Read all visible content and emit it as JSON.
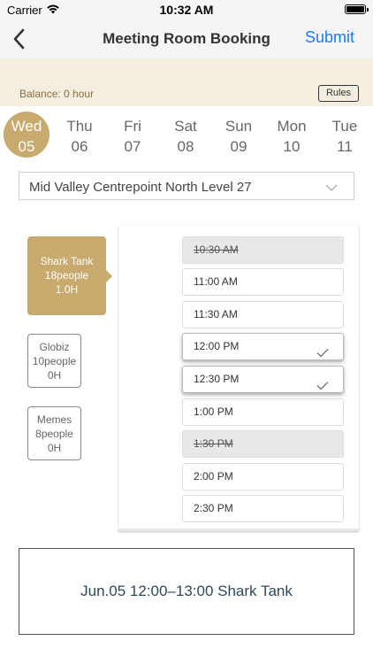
{
  "status_bar": {
    "carrier": "Carrier",
    "time": "10:32 AM"
  },
  "nav": {
    "title": "Meeting Room Booking",
    "submit_label": "Submit",
    "accent_color": "#1a7cf3"
  },
  "balance": {
    "text": "Balance: 0 hour",
    "rules_label": "Rules"
  },
  "dates": [
    {
      "dow": "Wed",
      "day": "05",
      "selected": true
    },
    {
      "dow": "Thu",
      "day": "06"
    },
    {
      "dow": "Fri",
      "day": "07"
    },
    {
      "dow": "Sat",
      "day": "08"
    },
    {
      "dow": "Sun",
      "day": "09"
    },
    {
      "dow": "Mon",
      "day": "10"
    },
    {
      "dow": "Tue",
      "day": "11"
    }
  ],
  "location": {
    "value": "Mid Valley Centrepoint North Level 27"
  },
  "rooms": [
    {
      "name": "Shark Tank",
      "capacity": "18people",
      "hours": "1.0H",
      "selected": true
    },
    {
      "name": "Globiz",
      "capacity": "10people",
      "hours": "0H"
    },
    {
      "name": "Memes",
      "capacity": "8people",
      "hours": "0H"
    }
  ],
  "slots": [
    {
      "time": "10:30 AM",
      "state": "disabled"
    },
    {
      "time": "11:00 AM",
      "state": "available"
    },
    {
      "time": "11:30 AM",
      "state": "available"
    },
    {
      "time": "12:00 PM",
      "state": "selected"
    },
    {
      "time": "12:30 PM",
      "state": "selected"
    },
    {
      "time": "1:00 PM",
      "state": "available"
    },
    {
      "time": "1:30 PM",
      "state": "disabled"
    },
    {
      "time": "2:00 PM",
      "state": "available"
    },
    {
      "time": "2:30 PM",
      "state": "available"
    }
  ],
  "summary": {
    "text": "Jun.05 12:00–13:00 Shark Tank"
  },
  "colors": {
    "gold": "#c8aa6e",
    "balance_bg": "#f3eee0"
  }
}
